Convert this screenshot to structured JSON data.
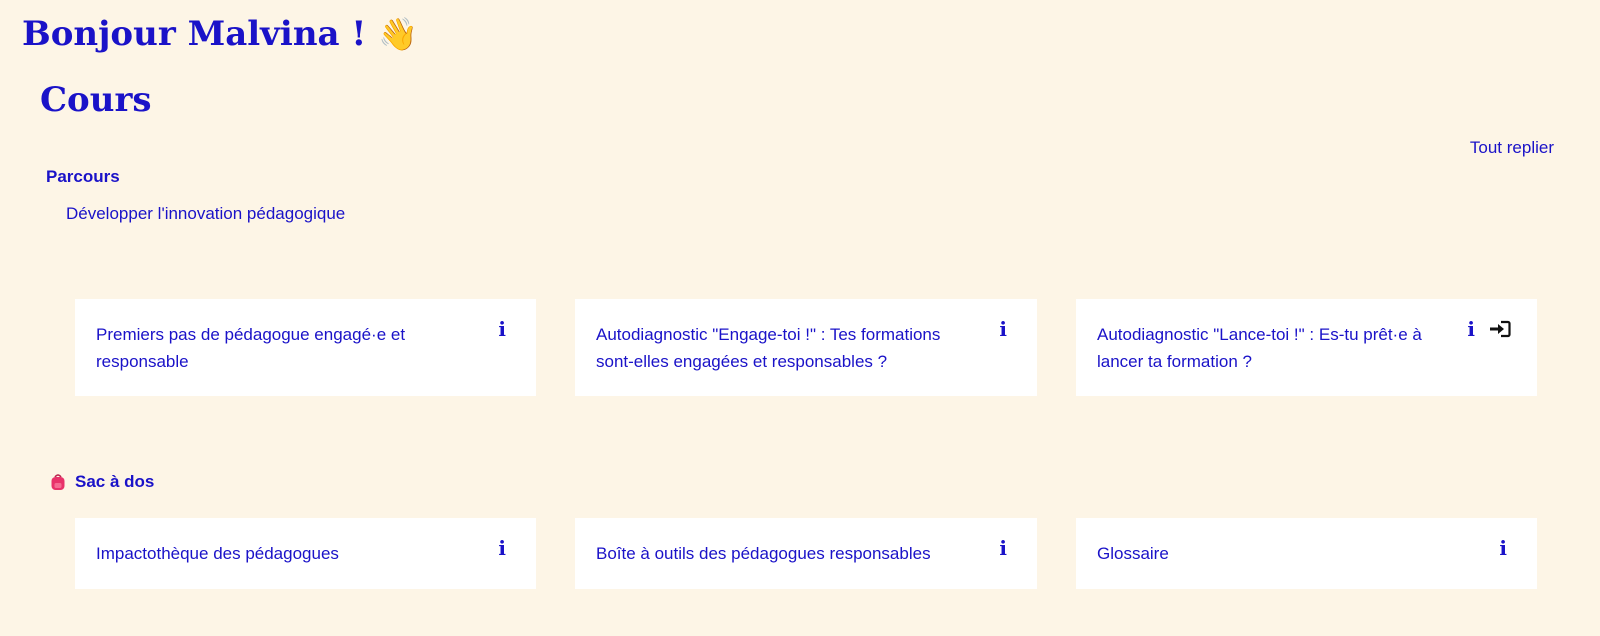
{
  "greeting": {
    "text": "Bonjour Malvina !",
    "emoji": "👋"
  },
  "courses": {
    "title": "Cours",
    "collapse_all": "Tout replier",
    "parcours": {
      "heading": "Parcours",
      "subcategory": "Développer l'innovation pédagogique",
      "cards": [
        {
          "title": "Premiers pas de pédagogue engagé·e et responsable",
          "info": "i"
        },
        {
          "title": "Autodiagnostic \"Engage-toi !\" : Tes formations sont-elles engagées et responsables ?",
          "info": "i"
        },
        {
          "title": "Autodiagnostic \"Lance-toi !\" : Es-tu prêt·e à lancer ta formation ?",
          "info": "i",
          "enter_icon": "sign-in-icon"
        }
      ]
    },
    "backpack": {
      "heading": "Sac à dos",
      "icon": "backpack-icon",
      "cards": [
        {
          "title": "Impactothèque des pédagogues",
          "info": "i"
        },
        {
          "title": "Boîte à outils des pédagogues responsables",
          "info": "i"
        },
        {
          "title": "Glossaire",
          "info": "i"
        }
      ]
    }
  },
  "colors": {
    "background": "#fdf5e6",
    "accent": "#1a12c8",
    "card": "#ffffff",
    "backpack": "#e8326a"
  }
}
